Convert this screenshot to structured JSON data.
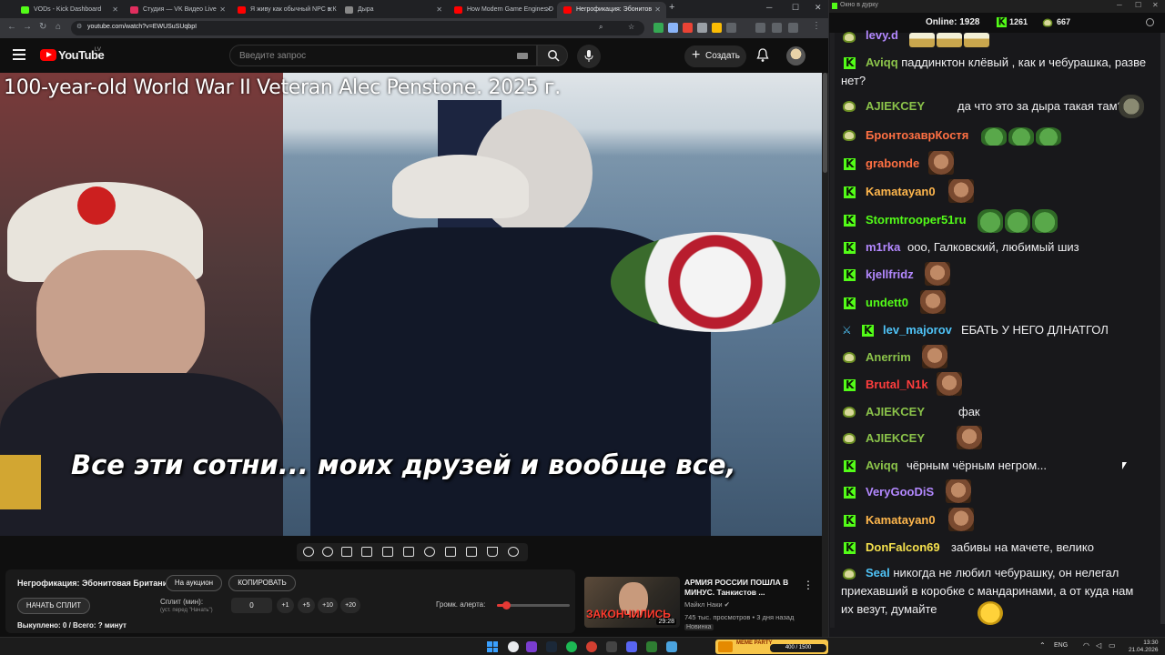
{
  "browser": {
    "tabs": [
      {
        "label": "VODs - Kick Dashboard",
        "color": "#53fc18"
      },
      {
        "label": "Студия — VK Видео Live",
        "color": "#e02e5e"
      },
      {
        "label": "Я живу как обычный NPC в К",
        "color": "#ff0000"
      },
      {
        "label": "Дыра",
        "color": "#888888"
      },
      {
        "label": "How Modern Game Engines D",
        "color": "#ff0000"
      },
      {
        "label": "Негрофикация: Эбонитов",
        "color": "#ff0000"
      }
    ],
    "url": "youtube.com/watch?v=EWUSuSUqbpI"
  },
  "youtube": {
    "logo_text": "YouTube",
    "country": "LV",
    "search_placeholder": "Введите запрос",
    "create_label": "Создать"
  },
  "video": {
    "overlay_title": "100-year-old World War II Veteran Alec Penstone. 2025 г.",
    "subtitle": "Все эти сотни... моих друзей и вообще все,"
  },
  "panel": {
    "stream_name": "Негрофикация: Эбонитовая Британия.",
    "auction_btn": "На аукцион",
    "copy_btn": "КОПИРОВАТЬ",
    "start_split_btn": "НАЧАТЬ СПЛИТ",
    "split_label": "Сплит (мин):",
    "split_hint": "(уст. перед \"Начать\")",
    "split_value": "0",
    "steps": [
      "+1",
      "+5",
      "+10",
      "+20"
    ],
    "bought": "Выкуплено: 0 / Всего: ? минут",
    "alert_label": "Громк. алерта:",
    "alert_volume": 0.12
  },
  "recommended": {
    "thumb_text": "ЗАКОНЧИЛИСЬ",
    "duration": "29:28",
    "title": "АРМИЯ РОССИИ ПОШЛА В МИНУС. Танкистов ...",
    "channel": "Майкл Наки",
    "meta": "745 тыс. просмотров • 3 дня назад",
    "badge": "Новинка"
  },
  "chat": {
    "window_title": "Окно в дурку",
    "online_label": "Online: 1928",
    "kick_viewers": "1261",
    "other_viewers": "667",
    "messages": [
      {
        "user": "levy.d",
        "text": "",
        "color": "#b388ff"
      },
      {
        "user": "Aviqq",
        "text": "паддинктон клёвый , как и чебурашка, разве нет?",
        "color": "#8bc34a"
      },
      {
        "user": "AJIEKCEY",
        "text": "да что это за дыра такая там?",
        "color": "#8bc34a"
      },
      {
        "user": "БронтозаврКостя",
        "text": "",
        "color": "#ff7043"
      },
      {
        "user": "grabonde",
        "text": "",
        "color": "#ff7043"
      },
      {
        "user": "Kamatayan0",
        "text": "",
        "color": "#ffb74d"
      },
      {
        "user": "Stormtrooper51ru",
        "text": "",
        "color": "#53fc18"
      },
      {
        "user": "m1rka",
        "text": "ооо, Галковский, любимый шиз",
        "color": "#b388ff"
      },
      {
        "user": "kjellfridz",
        "text": "",
        "color": "#b388ff"
      },
      {
        "user": "undett0",
        "text": "",
        "color": "#53fc18"
      },
      {
        "user": "lev_majorov",
        "text": "ЕБАТЬ У НЕГО ДЛНАТГОЛ",
        "color": "#4fc3f7"
      },
      {
        "user": "Anerrim",
        "text": "",
        "color": "#8bc34a"
      },
      {
        "user": "Brutal_N1k",
        "text": "",
        "color": "#ff3d3d"
      },
      {
        "user": "AJIEKCEY",
        "text": "фак",
        "color": "#8bc34a"
      },
      {
        "user": "AJIEKCEY",
        "text": "",
        "color": "#8bc34a"
      },
      {
        "user": "Aviqq",
        "text": "чёрным чёрным негром...",
        "color": "#8bc34a"
      },
      {
        "user": "VeryGooDiS",
        "text": "",
        "color": "#b388ff"
      },
      {
        "user": "Kamatayan0",
        "text": "",
        "color": "#ffb74d"
      },
      {
        "user": "DonFalcon69",
        "text": "забивы на мачете, велико",
        "color": "#f4e04d"
      },
      {
        "user": "Seal",
        "text": "никогда не любил чебурашку, он нелегал приехавший в коробке с мандаринами, а от куда нам их везут, думайте",
        "color": "#4fc3f7"
      }
    ]
  },
  "taskbar": {
    "meme_title": "MEME PARTY",
    "meme_progress": "400 / 1500",
    "lang": "ENG",
    "time": "13:30",
    "date": "21.04.2026"
  }
}
